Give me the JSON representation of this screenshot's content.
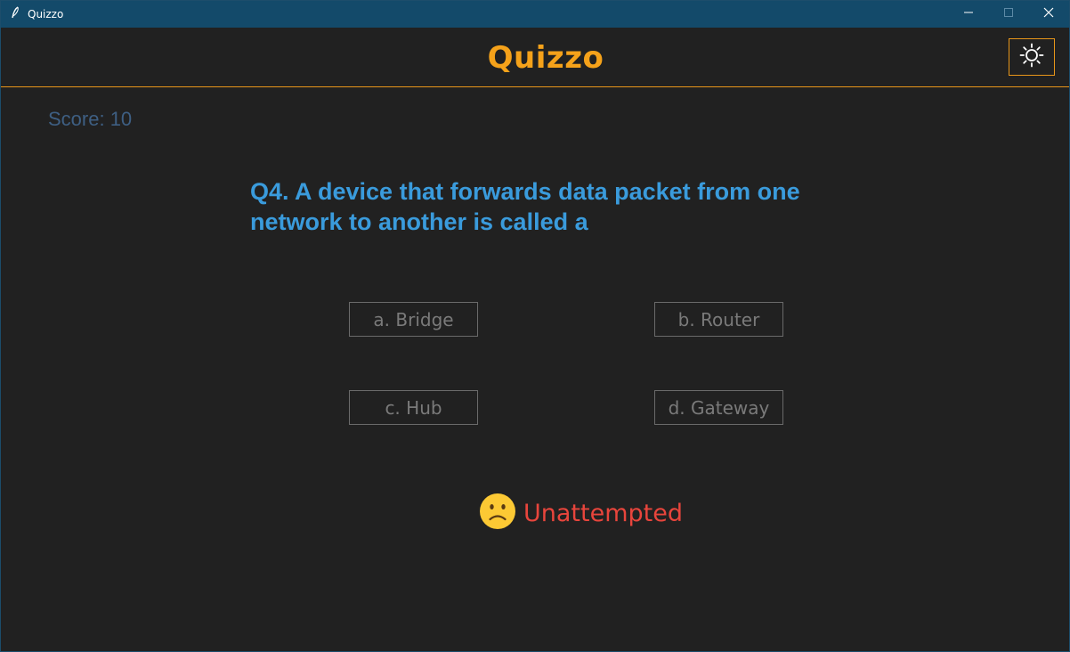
{
  "window": {
    "title": "Quizzo",
    "icon": "feather-icon",
    "controls": [
      "minimize-icon",
      "maximize-icon",
      "close-icon"
    ]
  },
  "header": {
    "title": "Quizzo",
    "theme_toggle_icon": "sun-icon"
  },
  "score": {
    "text": "Score: 10"
  },
  "question": {
    "text": "Q4. A device that forwards data packet from one network to another is called a"
  },
  "options": [
    {
      "label": "a. Bridge"
    },
    {
      "label": "b. Router"
    },
    {
      "label": "c. Hub"
    },
    {
      "label": "d. Gateway"
    }
  ],
  "status": {
    "icon": "sad-face-icon",
    "text": "Unattempted"
  },
  "colors": {
    "background": "#212121",
    "titlebar": "#134a6a",
    "accent": "#f5a21a",
    "question": "#3a9bdc",
    "score": "#3e5f83",
    "status": "#e8453c",
    "option_border": "#6a6a6a"
  }
}
